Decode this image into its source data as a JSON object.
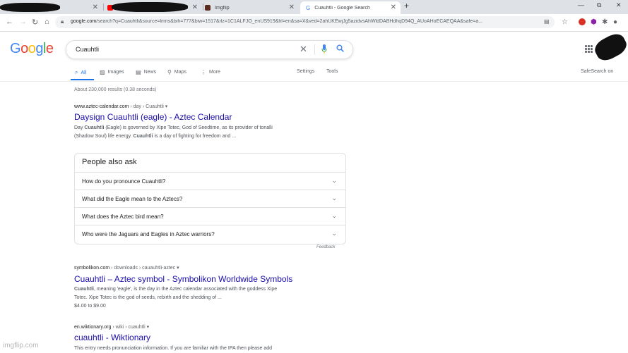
{
  "tabs": [
    {
      "title": "",
      "favicon_color": "#111111",
      "active": false
    },
    {
      "title": "",
      "favicon_color": "#ff0000",
      "active": false
    },
    {
      "title": "Imgflip",
      "favicon_color": "#5b2b1f",
      "active": false
    },
    {
      "title": "Cuauhtli - Google Search",
      "favicon_color": "#4285f4",
      "active": true
    }
  ],
  "window": {
    "minimize": "—",
    "maximize": "⧉",
    "close": "✕",
    "new_tab": "+"
  },
  "address_bar": {
    "domain": "google.com",
    "path": "/search?q=Cuauhtli&source=lmns&bih=777&biw=1517&rlz=1C1ALFJO_enUS919&hl=en&sa=X&ved=2ahUKEwjJg5azidvsAhWldDABHdhqD94Q_AUoAHoECAEQAA&safe=a..."
  },
  "logo": {
    "letters": [
      "G",
      "o",
      "o",
      "g",
      "l",
      "e"
    ],
    "colors": [
      "#4285f4",
      "#ea4335",
      "#fbbc05",
      "#4285f4",
      "#34a853",
      "#ea4335"
    ]
  },
  "search": {
    "query": "Cuauhtli"
  },
  "nav": {
    "all": "All",
    "images": "Images",
    "news": "News",
    "maps": "Maps",
    "more": "More",
    "settings": "Settings",
    "tools": "Tools",
    "safesearch": "SafeSearch on"
  },
  "stats": "About 230,000 results (0.38 seconds)",
  "results": [
    {
      "site": "www.aztec-calendar.com",
      "crumbs": " › day › Cuauhtli ▾",
      "title": "Daysign Cuauhtli (eagle) - Aztec Calendar",
      "line1_pre": "Day ",
      "line1_b": "Cuauhtli",
      "line1_post": " (Eagle) is governed by Xipe Totec, God of Seedtime, as its provider of tonalli",
      "line2_pre": "(Shadow Soul) life energy. ",
      "line2_b": "Cuauhtli",
      "line2_post": " is a day of fighting for freedom and ..."
    },
    {
      "site": "symbolikon.com",
      "crumbs": " › downloads › cauauhtli-aztec ▾",
      "title": "Cuauhtli – Aztec symbol - Symbolikon Worldwide Symbols",
      "line1_pre": "",
      "line1_b": "Cuauhtli",
      "line1_post": ", meaning 'eagle', is the day in the Aztec calendar associated with the goddess Xipe",
      "line2_pre": "Totec. Xipe Totec is the god of seeds, rebirth and the shedding of ...",
      "line2_b": "",
      "line2_post": "",
      "price": "$4.00 to $9.00"
    },
    {
      "site": "en.wiktionary.org",
      "crumbs": " › wiki › cuauhtli ▾",
      "title": "cuauhtli - Wiktionary",
      "line1_pre": "This entry needs pronunciation information. If you are familiar with the IPA then please add",
      "line1_b": "",
      "line1_post": ""
    }
  ],
  "people_also_ask": {
    "heading": "People also ask",
    "questions": [
      "How do you pronounce Cuauhtli?",
      "What did the Eagle mean to the Aztecs?",
      "What does the Aztec bird mean?",
      "Who were the Jaguars and Eagles in Aztec warriors?"
    ],
    "feedback": "Feedback"
  },
  "watermark": "imgflip.com"
}
